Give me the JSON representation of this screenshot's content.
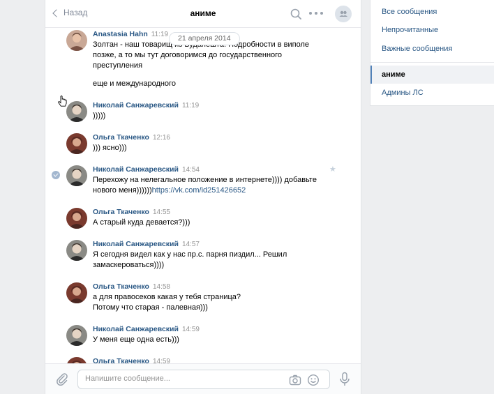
{
  "header": {
    "back_label": "Назад",
    "title": "аниме"
  },
  "date_separator": "21 апреля 2014",
  "messages": [
    {
      "author": "Anastasia Hahn",
      "time": "11:19",
      "lines": [
        "Золтан - наш товарищ из Будапешта. Подробности в виполе",
        "позже, а то мы тут договоримся до государственного",
        "преступления"
      ],
      "extra": "еще и международного"
    },
    {
      "author": "Николай Санжаревский",
      "time": "11:19",
      "lines": [
        ")))))"
      ]
    },
    {
      "author": "Ольга Ткаченко",
      "time": "12:16",
      "lines": [
        "))) ясно)))"
      ]
    },
    {
      "author": "Николай Санжаревский",
      "time": "14:54",
      "lines": [
        "Перехожу на нелегальное положение в интернете)))) добавьте"
      ],
      "line2_prefix": "нового меня))))))",
      "link": "https://vk.com/id251426652"
    },
    {
      "author": "Ольга Ткаченко",
      "time": "14:55",
      "lines": [
        "А старый куда девается?)))"
      ]
    },
    {
      "author": "Николай Санжаревский",
      "time": "14:57",
      "lines": [
        "Я сегодня видел как у нас пр.с. парня пиздил... Решил",
        "замаскероваться))))"
      ]
    },
    {
      "author": "Ольга Ткаченко",
      "time": "14:58",
      "lines": [
        "а для правосеков какая у тебя страница?",
        "Потому что старая - палевная)))"
      ]
    },
    {
      "author": "Николай Санжаревский",
      "time": "14:59",
      "lines": [
        "У меня еще одна есть)))"
      ]
    },
    {
      "author": "Ольга Ткаченко",
      "time": "14:59",
      "lines": []
    }
  ],
  "composer": {
    "placeholder": "Напишите сообщение..."
  },
  "right_menu": {
    "items": [
      "Все сообщения",
      "Непрочитанные",
      "Важные сообщения"
    ],
    "chats": [
      "аниме",
      "Админы ЛС"
    ]
  },
  "colors": {
    "link": "#2a5885",
    "accent": "#5181b8",
    "background": "#edeef0"
  }
}
